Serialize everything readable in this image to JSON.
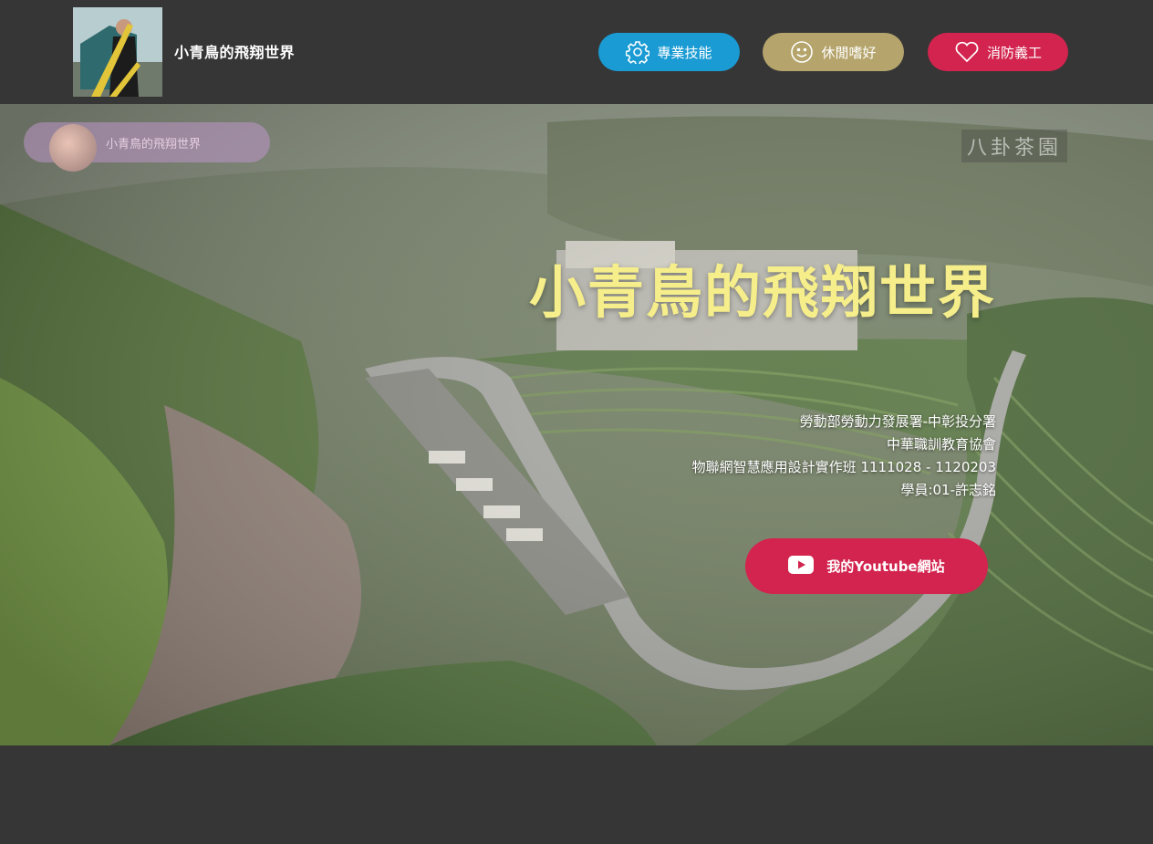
{
  "header": {
    "site_title": "小青鳥的飛翔世界",
    "nav": [
      {
        "label": "專業技能",
        "icon": "gear-icon",
        "color": "#1a9bd3"
      },
      {
        "label": "休閒嗜好",
        "icon": "smile-icon",
        "color": "#b5a46b"
      },
      {
        "label": "消防義工",
        "icon": "heart-icon",
        "color": "#d2244e"
      }
    ]
  },
  "hero": {
    "title": "小青鳥的飛翔世界",
    "lines": [
      "勞動部勞動力發展署-中彰投分署",
      "中華職訓教育協會",
      "物聯網智慧應用設計實作班 1111028 - 1120203",
      "學員:01-許志銘"
    ],
    "youtube_button": {
      "label": "我的Youtube網站",
      "icon": "youtube-icon",
      "color": "#d2244e"
    },
    "watermark_text": "小青鳥的飛翔世界",
    "corner_text": "八卦茶園"
  },
  "colors": {
    "background": "#363636",
    "title_yellow": "#f6ee8a"
  }
}
